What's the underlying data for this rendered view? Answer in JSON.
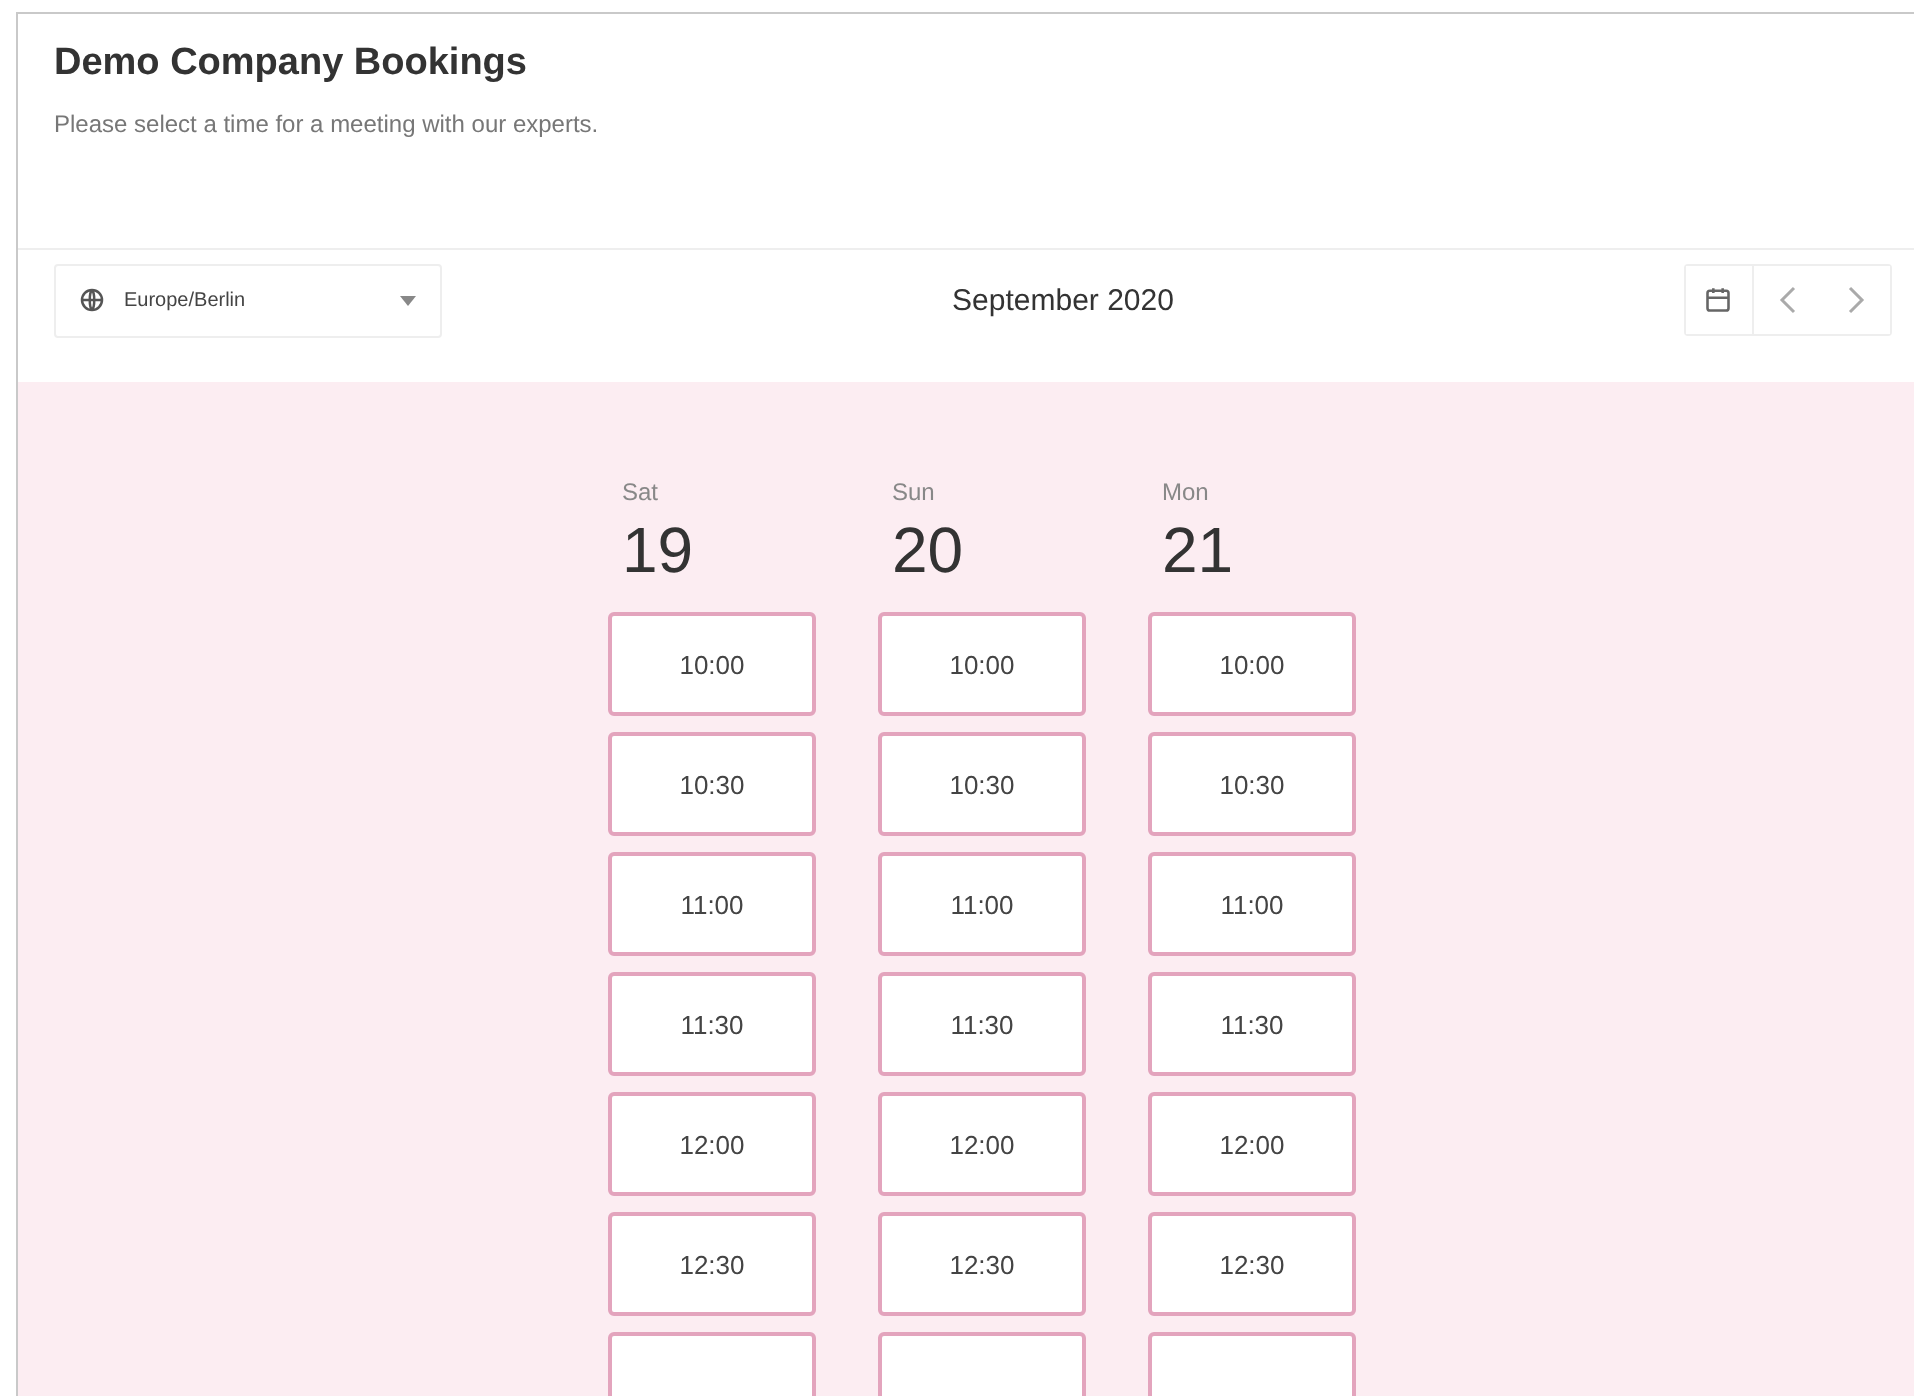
{
  "header": {
    "title": "Demo Company Bookings",
    "subtitle": "Please select a time for a meeting with our experts."
  },
  "toolbar": {
    "timezone": "Europe/Berlin",
    "month": "September 2020"
  },
  "days": [
    {
      "weekday": "Sat",
      "date": "19",
      "slots": [
        "10:00",
        "10:30",
        "11:00",
        "11:30",
        "12:00",
        "12:30"
      ]
    },
    {
      "weekday": "Sun",
      "date": "20",
      "slots": [
        "10:00",
        "10:30",
        "11:00",
        "11:30",
        "12:00",
        "12:30"
      ]
    },
    {
      "weekday": "Mon",
      "date": "21",
      "slots": [
        "10:00",
        "10:30",
        "11:00",
        "11:30",
        "12:00",
        "12:30"
      ]
    }
  ]
}
